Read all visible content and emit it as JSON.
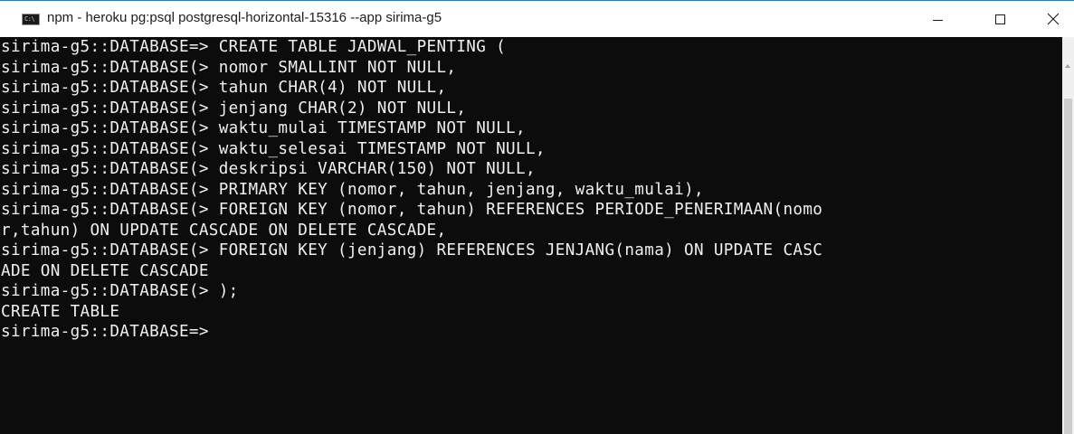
{
  "window": {
    "title": "npm - heroku  pg:psql postgresql-horizontal-15316 --app sirima-g5",
    "icon": "console-window-icon",
    "icon_text": "C:\\"
  },
  "controls": {
    "minimize": "minimize-icon",
    "maximize": "maximize-icon",
    "close": "×"
  },
  "console": {
    "background": "#0c0c0c",
    "foreground": "#f0f0f0",
    "lines": [
      "sirima-g5::DATABASE=> CREATE TABLE JADWAL_PENTING (",
      "sirima-g5::DATABASE(> nomor SMALLINT NOT NULL,",
      "sirima-g5::DATABASE(> tahun CHAR(4) NOT NULL,",
      "sirima-g5::DATABASE(> jenjang CHAR(2) NOT NULL,",
      "sirima-g5::DATABASE(> waktu_mulai TIMESTAMP NOT NULL,",
      "sirima-g5::DATABASE(> waktu_selesai TIMESTAMP NOT NULL,",
      "sirima-g5::DATABASE(> deskripsi VARCHAR(150) NOT NULL,",
      "sirima-g5::DATABASE(> PRIMARY KEY (nomor, tahun, jenjang, waktu_mulai),",
      "sirima-g5::DATABASE(> FOREIGN KEY (nomor, tahun) REFERENCES PERIODE_PENERIMAAN(nomo",
      "r,tahun) ON UPDATE CASCADE ON DELETE CASCADE,",
      "sirima-g5::DATABASE(> FOREIGN KEY (jenjang) REFERENCES JENJANG(nama) ON UPDATE CASC",
      "ADE ON DELETE CASCADE",
      "sirima-g5::DATABASE(> );",
      "CREATE TABLE",
      "sirima-g5::DATABASE=>"
    ]
  }
}
